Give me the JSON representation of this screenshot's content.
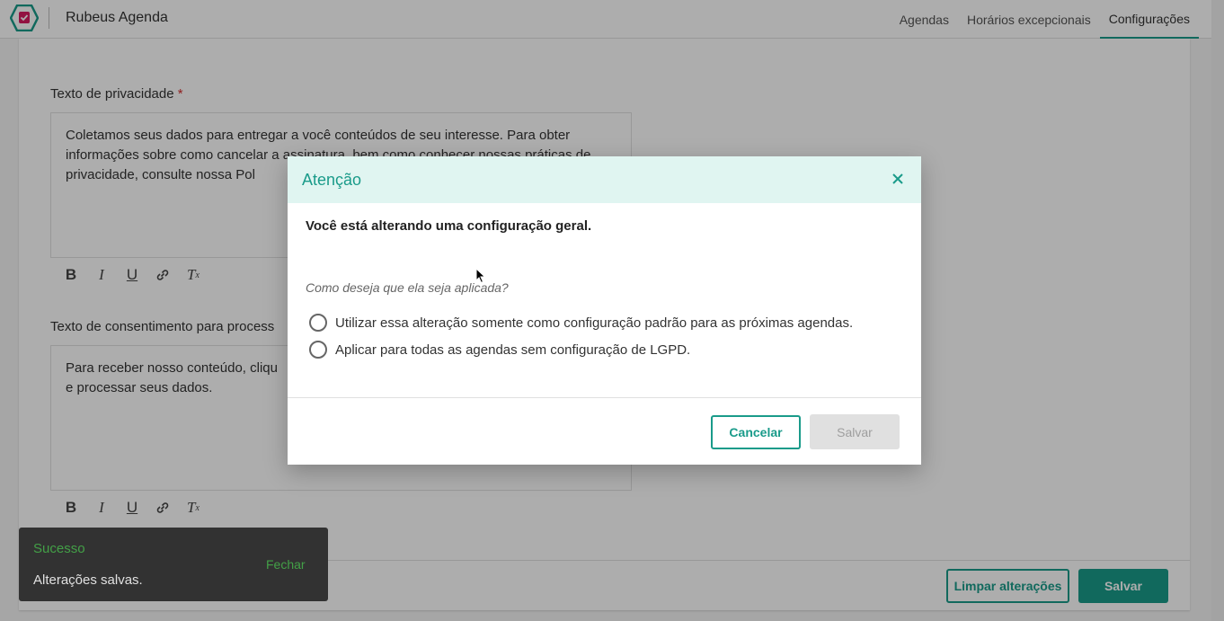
{
  "header": {
    "app_title": "Rubeus Agenda",
    "nav": [
      {
        "label": "Agendas",
        "active": false
      },
      {
        "label": "Horários excepcionais",
        "active": false
      },
      {
        "label": "Configurações",
        "active": true
      }
    ],
    "logo_icon": "calendar-check-hexagon-icon"
  },
  "form": {
    "privacy_label": "Texto de privacidade",
    "required_mark": "*",
    "privacy_text": "Coletamos seus dados para entregar a você conteúdos de seu interesse. Para obter informações sobre como cancelar a assinatura, bem como conhecer nossas práticas de privacidade, consulte nossa Pol",
    "consent_label": "Texto de consentimento para process",
    "consent_text": "Para receber nosso conteúdo, cliqu e processar seus dados.",
    "consent_line1": "Para receber nosso conteúdo, cliqu",
    "consent_line2": "e processar seus dados.",
    "toolbar_icons": [
      "bold-icon",
      "italic-icon",
      "underline-icon",
      "link-icon",
      "clear-format-icon"
    ]
  },
  "footer": {
    "clear_label": "Limpar alterações",
    "save_label": "Salvar"
  },
  "toast": {
    "title": "Sucesso",
    "message": "Alterações salvas.",
    "close_label": "Fechar"
  },
  "dialog": {
    "title": "Atenção",
    "bold_text": "Você está alterando uma configuração geral.",
    "question": "Como deseja que ela seja aplicada?",
    "options": [
      {
        "label": "Utilizar essa alteração somente como configuração padrão para as próximas agendas.",
        "selected": false
      },
      {
        "label": "Aplicar para todas as agendas sem configuração de LGPD.",
        "selected": false
      }
    ],
    "cancel_label": "Cancelar",
    "save_label": "Salvar",
    "save_disabled": true
  },
  "colors": {
    "accent": "#1a9b8a",
    "header_bg": "#e0f5f1",
    "toast_bg": "#323232",
    "toast_accent": "#43a047",
    "required": "#d32f2f"
  }
}
